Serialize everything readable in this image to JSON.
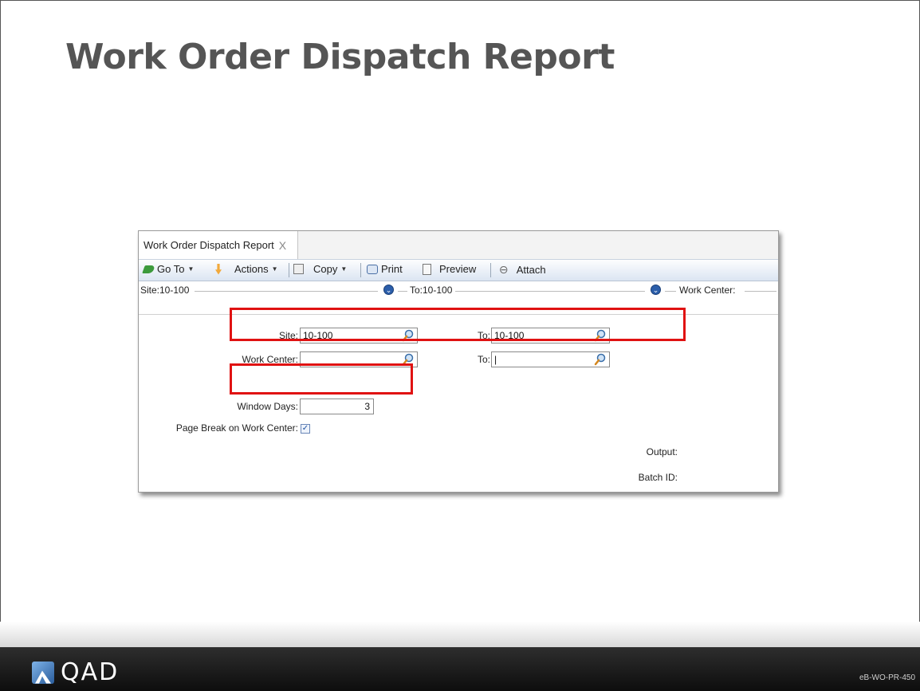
{
  "slide": {
    "title": "Work Order Dispatch Report",
    "code": "eB-WO-PR-450",
    "logo_text": "QAD"
  },
  "window": {
    "tab_label": "Work Order Dispatch Report",
    "tab_close": "X",
    "toolbar": {
      "goto": "Go To",
      "actions": "Actions",
      "copy": "Copy",
      "print": "Print",
      "preview": "Preview",
      "attach": "Attach"
    },
    "summary": {
      "site": "Site:10-100",
      "to": "To:10-100",
      "work_center": "Work Center:"
    },
    "form": {
      "site_label": "Site:",
      "site_value": "10-100",
      "site_to_label": "To:",
      "site_to_value": "10-100",
      "wc_label": "Work Center:",
      "wc_value": "",
      "wc_to_label": "To:",
      "wc_to_value": "|",
      "window_days_label": "Window Days:",
      "window_days_value": "3",
      "page_break_label": "Page Break on Work Center:",
      "page_break_checked": "✓",
      "output_label": "Output:",
      "batch_label": "Batch ID:"
    }
  },
  "colors": {
    "highlight": "#e01212",
    "toolbar_gradient_end": "#dbe5f2",
    "footer": "#1a1a1a"
  }
}
